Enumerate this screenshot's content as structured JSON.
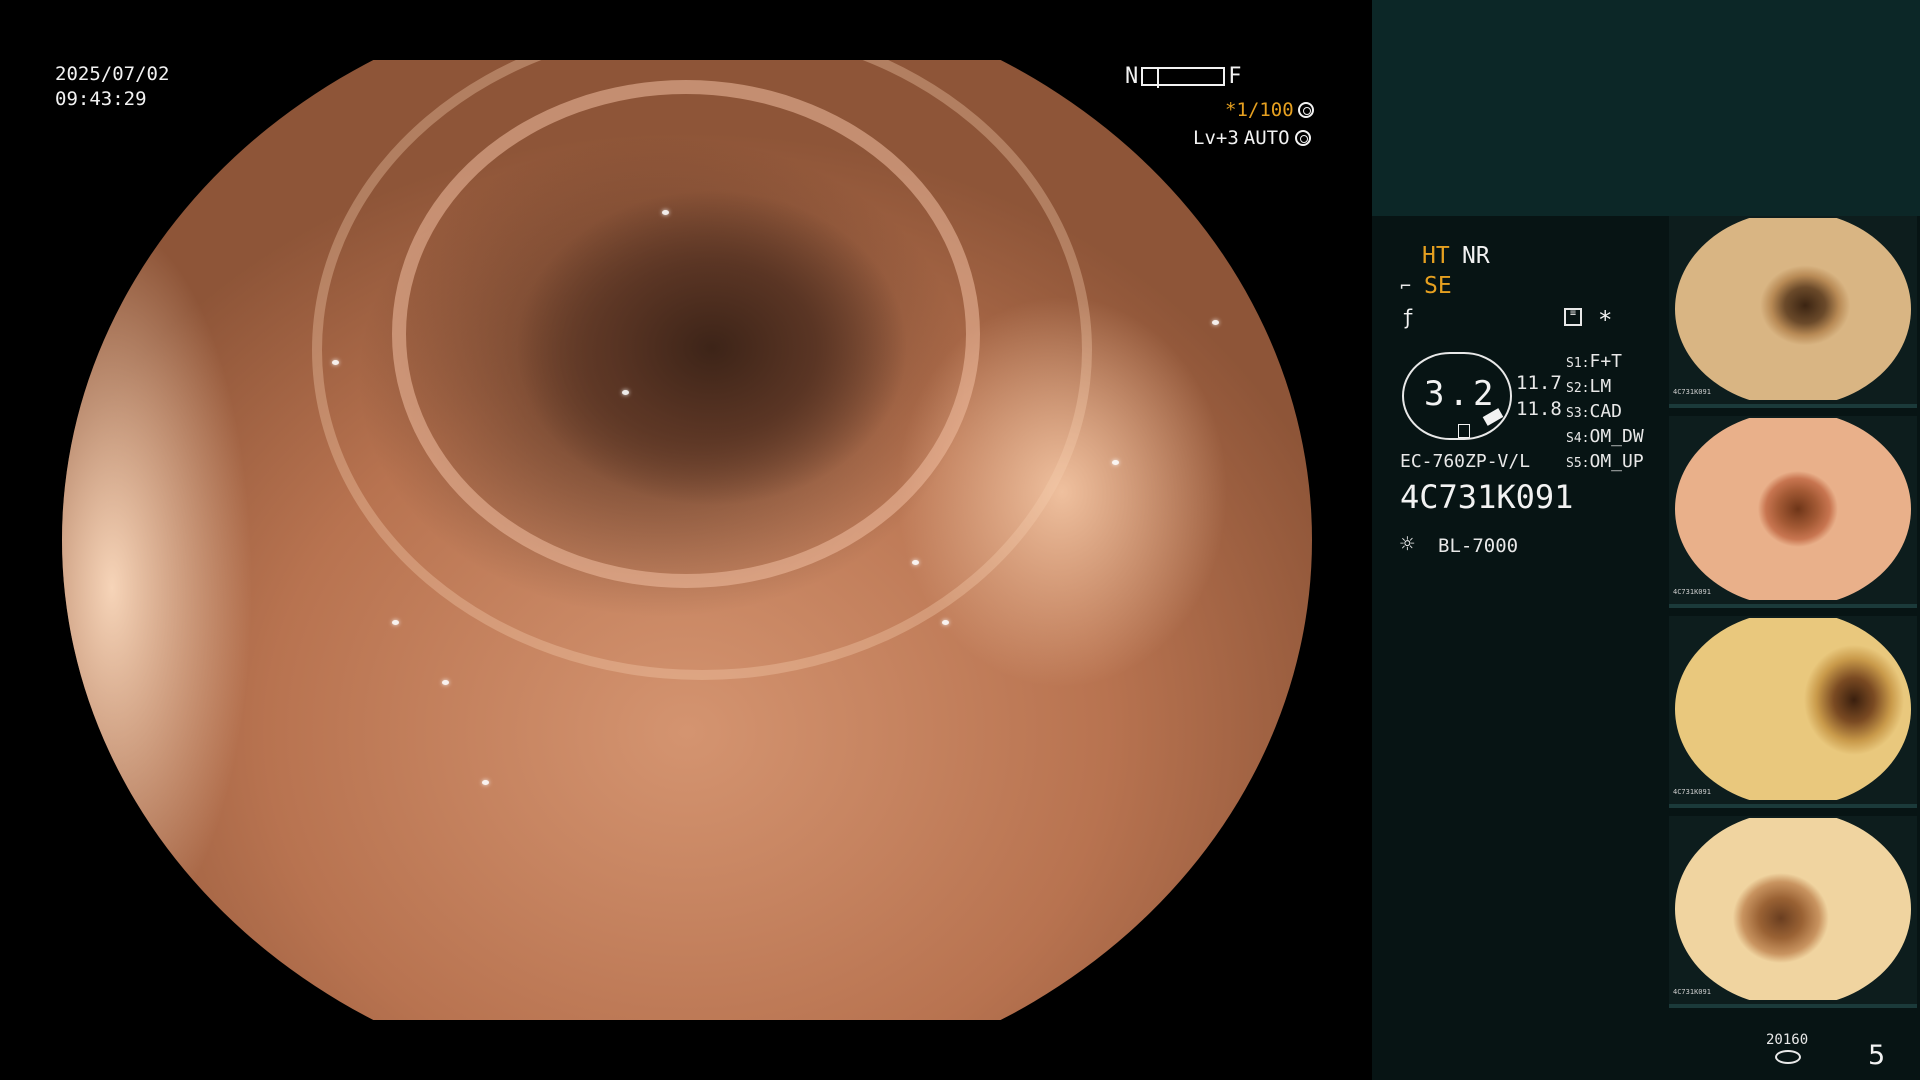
{
  "overlay": {
    "date": "2025/07/02",
    "time": "09:43:29",
    "near_label": "N",
    "far_label": "F",
    "shutter": "*1/100",
    "iris_level": "Lv+3",
    "iris_mode": "AUTO"
  },
  "status": {
    "ht": "HT",
    "nr": "NR",
    "se": "SE",
    "asterisk": "*"
  },
  "scope": {
    "ring_value": "3.2",
    "value_top": "11.7",
    "value_bottom": "11.8",
    "model": "EC-760ZP-V/L",
    "serial": "4C731K091",
    "light_source": "BL-7000"
  },
  "settings": [
    {
      "key": "S1:",
      "value": "F+T"
    },
    {
      "key": "S2:",
      "value": "LM"
    },
    {
      "key": "S3:",
      "value": "CAD"
    },
    {
      "key": "S4:",
      "value": "OM_DW"
    },
    {
      "key": "S5:",
      "value": "OM_UP"
    }
  ],
  "thumbnails": [
    {
      "tag": "4C731K091"
    },
    {
      "tag": "4C731K091"
    },
    {
      "tag": "4C731K091"
    },
    {
      "tag": "4C731K091"
    }
  ],
  "recording": {
    "count": "20160",
    "page": "5"
  },
  "icons": [
    "shutter-icon",
    "iris-icon",
    "scope-icon",
    "freeze-icon",
    "memo-icon",
    "light-icon",
    "disk-icon"
  ],
  "colors": {
    "accent_orange": "#e6a020",
    "panel_bg": "#071414",
    "panel_top": "#0c2727"
  }
}
